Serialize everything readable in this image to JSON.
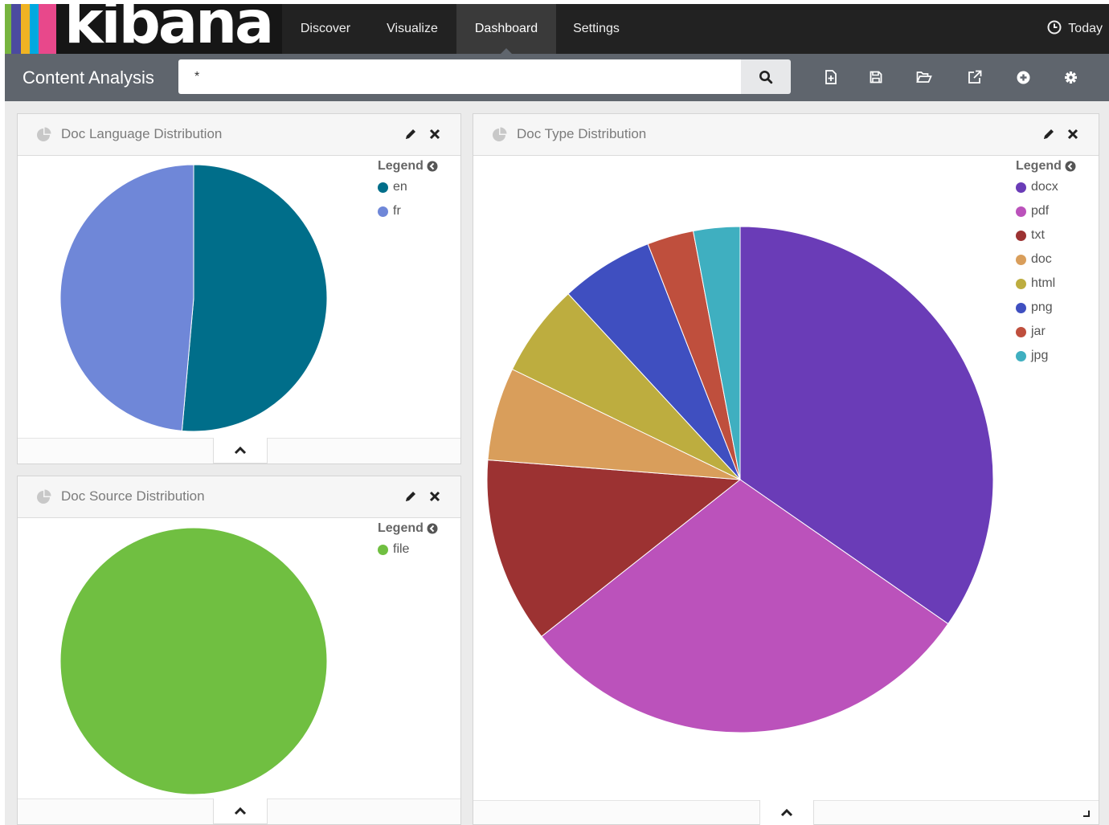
{
  "app": {
    "logo_text": "kibana",
    "nav": [
      {
        "label": "Discover",
        "active": false
      },
      {
        "label": "Visualize",
        "active": false
      },
      {
        "label": "Dashboard",
        "active": true
      },
      {
        "label": "Settings",
        "active": false
      }
    ],
    "time_label": "Today",
    "time_icon": "clock-icon"
  },
  "dashboard": {
    "title": "Content Analysis",
    "query": "*",
    "toolbar_icons": [
      "new-dashboard-icon",
      "save-icon",
      "open-icon",
      "share-icon",
      "add-visualization-icon",
      "settings-icon"
    ]
  },
  "panels": [
    {
      "id": "lang",
      "title": "Doc Language Distribution",
      "legend_title": "Legend"
    },
    {
      "id": "source",
      "title": "Doc Source Distribution",
      "legend_title": "Legend"
    },
    {
      "id": "type",
      "title": "Doc Type Distribution",
      "legend_title": "Legend"
    }
  ],
  "colors": {
    "navbar": "#222222",
    "subbar": "#5f656d",
    "logo_stripes": [
      "#77b43f",
      "#4b4b9f",
      "#f0b323",
      "#00a9e0",
      "#e8488b"
    ]
  },
  "chart_data": [
    {
      "type": "pie",
      "categories": [
        "en",
        "fr"
      ],
      "values": [
        51.4,
        48.6
      ],
      "colors": [
        "#006e8a",
        "#6f87d8"
      ],
      "legend": "top-right"
    },
    {
      "type": "pie",
      "categories": [
        "file"
      ],
      "values": [
        100
      ],
      "colors": [
        "#70bf41"
      ],
      "legend": "top-right"
    },
    {
      "type": "pie",
      "categories": [
        "docx",
        "pdf",
        "txt",
        "doc",
        "html",
        "png",
        "jar",
        "jpg"
      ],
      "values": [
        35,
        30,
        12,
        6,
        6,
        6,
        3,
        3
      ],
      "colors": [
        "#6a3cb7",
        "#bb52bb",
        "#9c3232",
        "#d99e5b",
        "#bdad3f",
        "#3f4fc0",
        "#bf4f3d",
        "#3fafc0"
      ],
      "legend": "top-right"
    }
  ]
}
